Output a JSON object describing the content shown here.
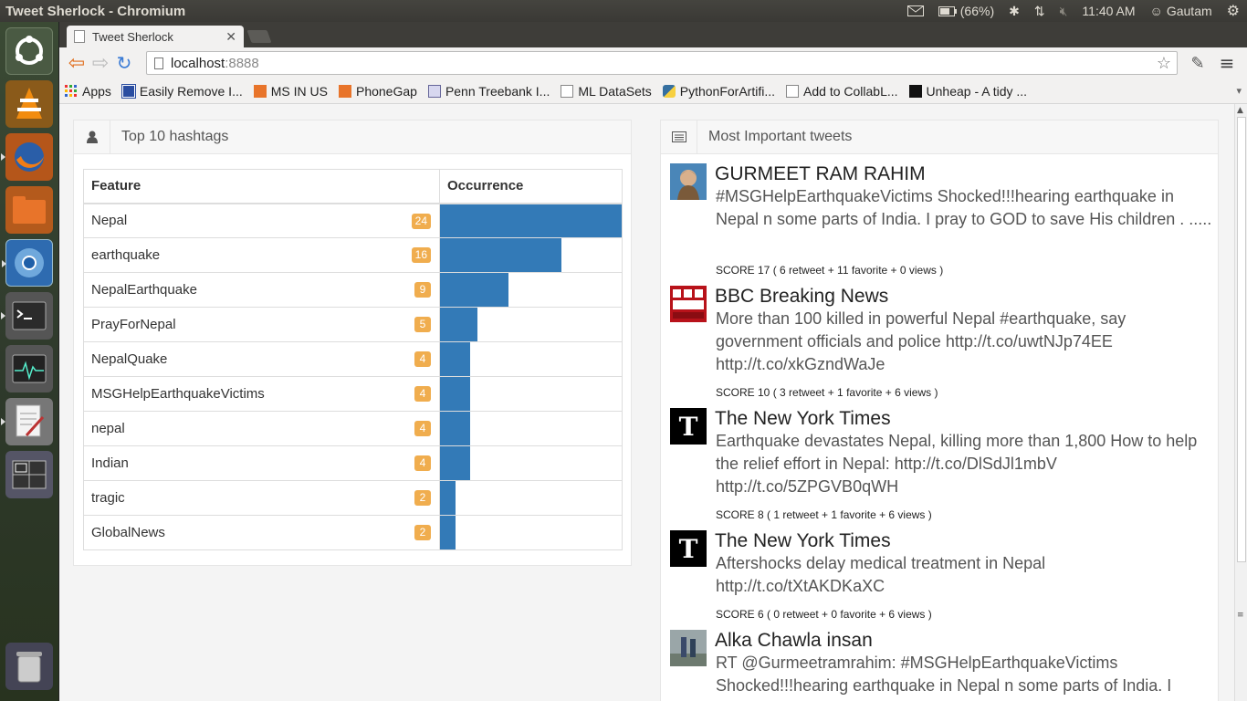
{
  "system": {
    "window_title": "Tweet Sherlock - Chromium",
    "battery": "(66%)",
    "time": "11:40 AM",
    "user": "Gautam"
  },
  "browser": {
    "tab_title": "Tweet Sherlock",
    "url_host": "localhost",
    "url_port": ":8888",
    "bookmarks": [
      "Apps",
      "Easily Remove I...",
      "MS  IN  US",
      "PhoneGap",
      "Penn Treebank I...",
      "ML DataSets",
      "PythonForArtifi...",
      "Add to CollabL...",
      "Unheap - A tidy ..."
    ]
  },
  "hashtags_panel": {
    "title": "Top 10 hashtags",
    "col_feature": "Feature",
    "col_occurrence": "Occurrence",
    "max": 24,
    "rows": [
      {
        "feature": "Nepal",
        "count": 24
      },
      {
        "feature": "earthquake",
        "count": 16
      },
      {
        "feature": "NepalEarthquake",
        "count": 9
      },
      {
        "feature": "PrayForNepal",
        "count": 5
      },
      {
        "feature": "NepalQuake",
        "count": 4
      },
      {
        "feature": "MSGHelpEarthquakeVictims",
        "count": 4
      },
      {
        "feature": "nepal",
        "count": 4
      },
      {
        "feature": "Indian",
        "count": 4
      },
      {
        "feature": "tragic",
        "count": 2
      },
      {
        "feature": "GlobalNews",
        "count": 2
      }
    ]
  },
  "tweets_panel": {
    "title": "Most Important tweets",
    "tweets": [
      {
        "name": "GURMEET RAM RAHIM",
        "text": "#MSGHelpEarthquakeVictims Shocked!!!hearing earthquake in Nepal n some parts of India. I pray to GOD to save His children . .....",
        "score": "SCORE 17    ( 6 retweet +  11 favorite +  0 views )"
      },
      {
        "name": "BBC Breaking News",
        "text": "More than 100 killed in powerful Nepal #earthquake, say government officials and police http://t.co/uwtNJp74EE http://t.co/xkGzndWaJe",
        "score": "SCORE 10    ( 3 retweet +  1 favorite +  6 views )"
      },
      {
        "name": "The New York Times",
        "text": "Earthquake devastates Nepal, killing more than 1,800 How to help the relief effort in Nepal: http://t.co/DlSdJl1mbV http://t.co/5ZPGVB0qWH",
        "score": "SCORE 8    ( 1 retweet +  1 favorite +  6 views )"
      },
      {
        "name": "The New York Times",
        "text": "Aftershocks delay medical treatment in Nepal http://t.co/tXtAKDKaXC",
        "score": "SCORE 6    ( 0 retweet +  0 favorite +  6 views )"
      },
      {
        "name": "Alka Chawla insan",
        "text": "RT @Gurmeetramrahim: #MSGHelpEarthquakeVictims Shocked!!!hearing earthquake in Nepal n some parts of India. I",
        "score": ""
      }
    ]
  }
}
